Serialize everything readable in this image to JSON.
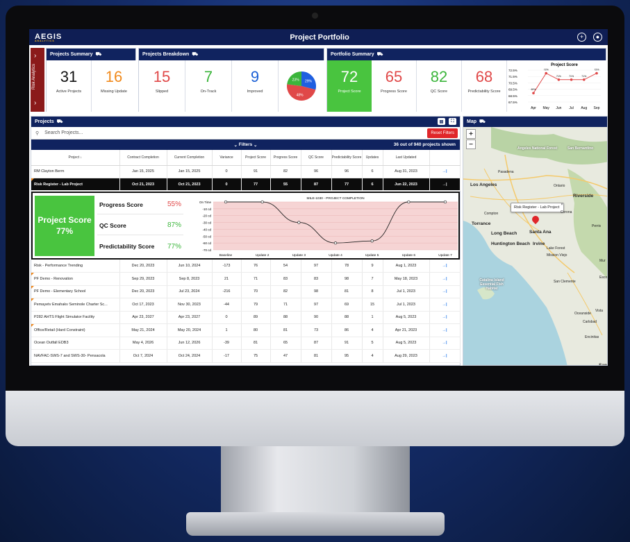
{
  "app": {
    "title": "Project Portfolio",
    "logo_main": "AEGIS",
    "logo_sub": "ANALYTICS"
  },
  "risk_sidebar": {
    "label": "Risk Analytics"
  },
  "summary": {
    "projects_summary": {
      "title": "Projects Summary",
      "tiles": [
        {
          "value": "31",
          "label": "Active Projects",
          "color": "#111111"
        },
        {
          "value": "16",
          "label": "Missing Update",
          "color": "#f18a1c"
        }
      ]
    },
    "breakdown": {
      "title": "Projects Breakdown",
      "tiles": [
        {
          "value": "15",
          "label": "Slipped",
          "color": "#e04848"
        },
        {
          "value": "7",
          "label": "On-Track",
          "color": "#3bb53b"
        },
        {
          "value": "9",
          "label": "Improved",
          "color": "#1a5fd6"
        }
      ],
      "pie": [
        {
          "label": "29%",
          "value": 29,
          "color": "#1f5fe0"
        },
        {
          "label": "48%",
          "value": 48,
          "color": "#e04848"
        },
        {
          "label": "23%",
          "value": 23,
          "color": "#3bb53b"
        }
      ]
    },
    "portfolio": {
      "title": "Portfolio Summary",
      "tiles": [
        {
          "value": "72",
          "label": "Project Score",
          "color": "#ffffff",
          "bg": "#49c43f"
        },
        {
          "value": "65",
          "label": "Progress Score",
          "color": "#e04848"
        },
        {
          "value": "82",
          "label": "QC Score",
          "color": "#3bb53b"
        },
        {
          "value": "68",
          "label": "Predictability Score",
          "color": "#e04848"
        }
      ]
    },
    "mini_chart": {
      "title": "Project Score",
      "y_ticks": [
        "72.5%",
        "71.5%",
        "70.5%",
        "69.5%",
        "68.5%",
        "67.5%"
      ],
      "x": [
        "Apr",
        "May",
        "Jun",
        "Jul",
        "Aug",
        "Sep"
      ],
      "point_labels": [
        "",
        "72%",
        "71%",
        "71%",
        "71%",
        "72%"
      ],
      "first_label": "69%"
    }
  },
  "projects": {
    "title": "Projects",
    "search_placeholder": "Search Projects...",
    "reset_label": "Reset Filters",
    "filters_label": "Filters",
    "count_label": "36 out of 940 projects shown",
    "columns": [
      "Project ↓",
      "Contract Completion",
      "Current Completion",
      "Variance",
      "Project Score",
      "Progress Score",
      "QC Score",
      "Predictability Score",
      "Updates",
      "Last Updated",
      ""
    ],
    "rows_top": [
      {
        "name": "RM Clayton Berm",
        "contract": "Jan 15, 2025",
        "current": "Jan 15, 2025",
        "variance": "0",
        "project": "91",
        "progress": "82",
        "qc": "96",
        "predict": "96",
        "updates": "6",
        "last": "Aug 31, 2023",
        "flag": false
      },
      {
        "name": "Risk Register - Lab Project",
        "contract": "Oct 21, 2023",
        "current": "Oct 21, 2023",
        "variance": "0",
        "project": "77",
        "progress": "55",
        "qc": "87",
        "predict": "77",
        "updates": "6",
        "last": "Jun 22, 2023",
        "flag": true
      }
    ],
    "rows_bottom": [
      {
        "name": "Risk - Performance Trending",
        "contract": "Dec 20, 2023",
        "current": "Jun 10, 2024",
        "variance": "-173",
        "project": "76",
        "progress": "54",
        "qc": "97",
        "predict": "78",
        "updates": "9",
        "last": "Aug 1, 2023",
        "flag": false
      },
      {
        "name": "PF Demo - Renovation",
        "contract": "Sep 29, 2023",
        "current": "Sep 8, 2023",
        "variance": "21",
        "project": "71",
        "progress": "83",
        "qc": "83",
        "predict": "98",
        "updates": "7",
        "last": "May 18, 2023",
        "flag": true
      },
      {
        "name": "PF Demo - Elementary School",
        "contract": "Dec 20, 2023",
        "current": "Jul 23, 2024",
        "variance": "-216",
        "project": "70",
        "progress": "82",
        "qc": "98",
        "predict": "81",
        "updates": "8",
        "last": "Jul 1, 2023",
        "flag": true
      },
      {
        "name": "Pemayetv Emahakv Seminole Charter Sc...",
        "contract": "Oct 17, 2023",
        "current": "Nov 30, 2023",
        "variance": "-44",
        "project": "79",
        "progress": "71",
        "qc": "97",
        "predict": "69",
        "updates": "15",
        "last": "Jul 1, 2023",
        "flag": true
      },
      {
        "name": "P282 AHTS Flight Simulator Facility",
        "contract": "Apr 23, 2027",
        "current": "Apr 23, 2027",
        "variance": "0",
        "project": "89",
        "progress": "88",
        "qc": "90",
        "predict": "88",
        "updates": "1",
        "last": "Aug 5, 2023",
        "flag": false
      },
      {
        "name": "Office/Retail (Hard Constraint)",
        "contract": "May 21, 2024",
        "current": "May 20, 2024",
        "variance": "1",
        "project": "80",
        "progress": "81",
        "qc": "73",
        "predict": "86",
        "updates": "4",
        "last": "Apr 21, 2023",
        "flag": true
      },
      {
        "name": "Ocean Outfall EDB3",
        "contract": "May 4, 2026",
        "current": "Jun 12, 2026",
        "variance": "-39",
        "project": "81",
        "progress": "65",
        "qc": "87",
        "predict": "91",
        "updates": "5",
        "last": "Aug 5, 2023",
        "flag": false
      },
      {
        "name": "NAVFAC-SWS-7 and SWS-30- Pensacola",
        "contract": "Oct 7, 2024",
        "current": "Oct 24, 2024",
        "variance": "-17",
        "project": "75",
        "progress": "47",
        "qc": "81",
        "predict": "95",
        "updates": "4",
        "last": "Aug 29, 2023",
        "flag": false
      }
    ],
    "detail": {
      "big_label": "Project Score",
      "big_value": "77%",
      "scores": [
        {
          "label": "Progress Score",
          "value": "55%",
          "color": "#e04848"
        },
        {
          "label": "QC Score",
          "value": "87%",
          "color": "#3bb53b"
        },
        {
          "label": "Predictability Score",
          "value": "77%",
          "color": "#3bb53b"
        }
      ],
      "chart_title": "MILE-1030 - PROJECT COMPLETION"
    }
  },
  "map": {
    "title": "Map",
    "tooltip": "Risk Register - Lab Project",
    "labels": [
      "Angeles National Forest",
      "San Bernardino",
      "Pasadena",
      "Los Angeles",
      "Ontario",
      "Riverside",
      "Compton",
      "Corona",
      "Torrance",
      "Long Beach",
      "Santa Ana",
      "Huntington Beach",
      "Irvine",
      "Lake Forest",
      "Mission Viejo",
      "Perris",
      "Catalina Island Essential Fish Habitat",
      "San Clemente",
      "Oceanside",
      "Vista",
      "Carlsbad",
      "Encinitas",
      "San",
      "Escondido",
      "Mur"
    ]
  },
  "chart_data": [
    {
      "type": "line",
      "title": "Project Score",
      "x": [
        "Apr",
        "May",
        "Jun",
        "Jul",
        "Aug",
        "Sep"
      ],
      "y_ticks": [
        "72.5%",
        "71.5%",
        "70.5%",
        "69.5%",
        "68.5%",
        "67.5%"
      ],
      "series": [
        {
          "values": [
            68.9,
            72.0,
            71.0,
            71.0,
            71.0,
            72.0
          ]
        }
      ],
      "ylim": [
        67.5,
        72.5
      ],
      "color": "#e04848"
    },
    {
      "type": "line",
      "title": "MILE-1030 - PROJECT COMPLETION",
      "categories": [
        "Baseline",
        "Update 2",
        "Update 3",
        "Update 4",
        "Update 5",
        "Update 6",
        "Update 7"
      ],
      "y_ticks": [
        "On Time",
        "-10 cd",
        "-20 cd",
        "-30 cd",
        "-40 cd",
        "-50 cd",
        "-60 cd",
        "-70 cd"
      ],
      "series": [
        {
          "values": [
            0,
            0,
            -30,
            -60,
            -57,
            0,
            0
          ]
        }
      ],
      "ylim": [
        -70,
        0
      ]
    },
    {
      "type": "pie",
      "labels": [
        "29%",
        "48%",
        "23%"
      ],
      "values": [
        29,
        48,
        23
      ]
    }
  ]
}
